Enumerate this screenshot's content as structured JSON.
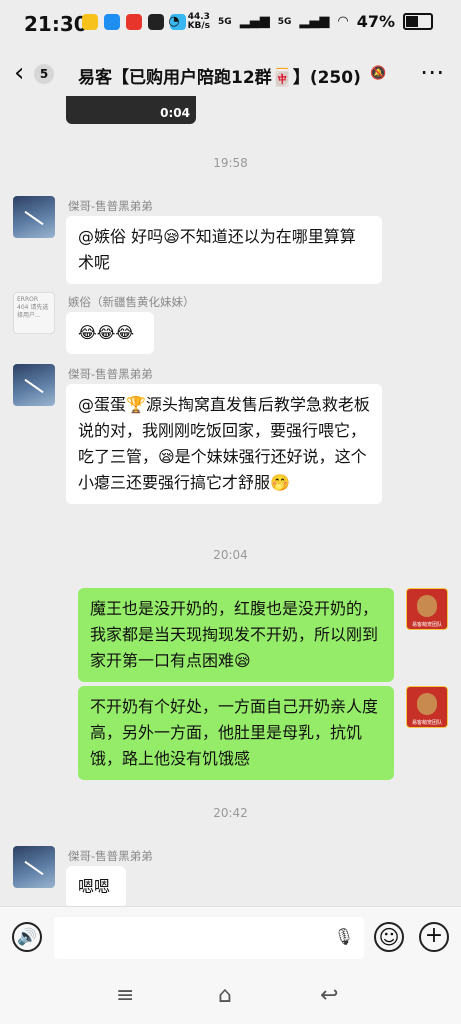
{
  "status": {
    "time": "21:30",
    "net_speed_value": "44.3",
    "net_speed_unit": "KB/s",
    "signal_1": "5G",
    "signal_2": "5G",
    "battery": "47%",
    "app_icons": [
      "notification-app-yellow",
      "notification-app-blue",
      "notification-app-red",
      "notification-app-black",
      "notification-app-cyan"
    ]
  },
  "header": {
    "unread_count": "5",
    "title": "易客【已购用户陪跑12群🀄】(250)"
  },
  "chat": {
    "video_duration": "0:04",
    "timestamps": [
      "19:58",
      "20:04",
      "20:42"
    ],
    "messages": [
      {
        "sender": "傑哥-售普黑弟弟",
        "text": "@嫉俗  好吗😪不知道还以为在哪里算算术呢"
      },
      {
        "sender": "嫉俗（新疆售黄化妹妹）",
        "text": "😂😂😂",
        "avatar_text": "ERROR 404 请先选择用户..."
      },
      {
        "sender": "傑哥-售普黑弟弟",
        "text": "@蛋蛋🏆源头掏窝直发售后教学急救老板说的对，我刚刚吃饭回家，要强行喂它，吃了三管，😪是个妹妹强行还好说，这个小瘪三还要强行搞它才舒服🤭"
      },
      {
        "sender": "me",
        "text": "魔王也是没开奶的，红腹也是没开奶的，我家都是当天现掏现发不开奶，所以刚到家开第一口有点困难😪",
        "avatar_text": "易客萌宠团队"
      },
      {
        "sender": "me",
        "text": "不开奶有个好处，一方面自己开奶亲人度高，另外一方面，他肚里是母乳，抗饥饿，路上他没有饥饿感",
        "avatar_text": "易客萌宠团队"
      },
      {
        "sender": "傑哥-售普黑弟弟",
        "text": "嗯嗯"
      }
    ]
  },
  "input": {
    "placeholder": ""
  },
  "icons": {
    "back": "‹",
    "voice": "🔊",
    "mic": "🎙",
    "emoji": "☺",
    "plus": "+",
    "menu": "≡",
    "home": "⌂",
    "return": "↩"
  }
}
